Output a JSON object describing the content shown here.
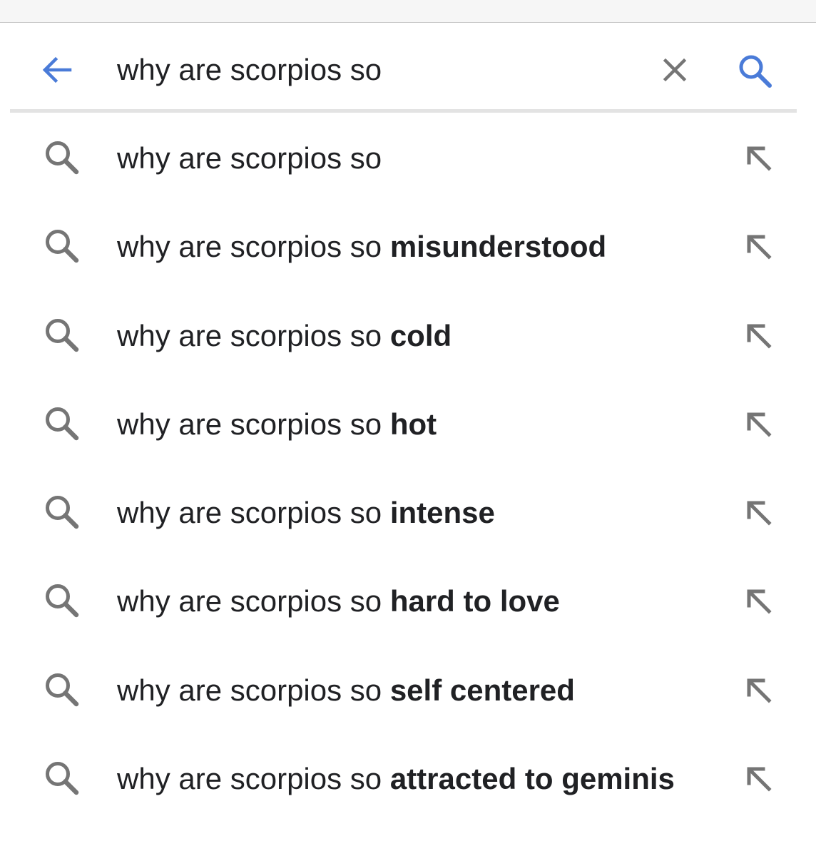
{
  "search": {
    "query": "why are scorpios so",
    "accent_color": "#4a7bd8",
    "icon_gray": "#757575",
    "icons": {
      "back": "arrow-left-icon",
      "clear": "close-icon",
      "submit": "search-icon",
      "suggestion": "search-icon",
      "fill": "arrow-up-left-icon"
    }
  },
  "suggestions": [
    {
      "prefix": "why are scorpios so",
      "completion": ""
    },
    {
      "prefix": "why are scorpios so ",
      "completion": "misunderstood"
    },
    {
      "prefix": "why are scorpios so ",
      "completion": "cold"
    },
    {
      "prefix": "why are scorpios so ",
      "completion": "hot"
    },
    {
      "prefix": "why are scorpios so ",
      "completion": "intense"
    },
    {
      "prefix": "why are scorpios so ",
      "completion": "hard to love"
    },
    {
      "prefix": "why are scorpios so ",
      "completion": "self centered"
    },
    {
      "prefix": "why are scorpios so ",
      "completion": "attracted to geminis"
    }
  ]
}
